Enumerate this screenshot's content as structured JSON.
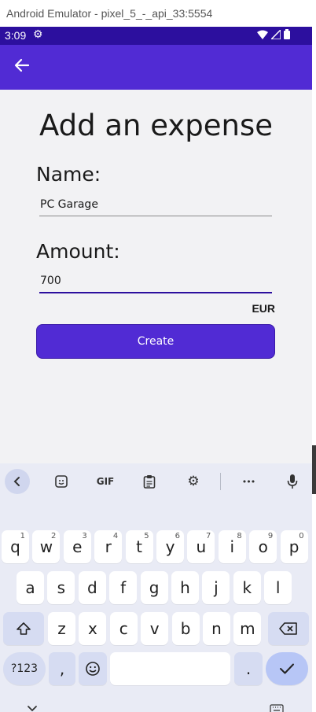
{
  "window": {
    "title": "Android Emulator - pixel_5_-_api_33:5554"
  },
  "status_bar": {
    "time": "3:09"
  },
  "app_bar": {
    "back_icon": "arrow-left-icon"
  },
  "form": {
    "title": "Add an expense",
    "name_label": "Name:",
    "name_value": "PC Garage",
    "amount_label": "Amount:",
    "amount_value": "700",
    "currency": "EUR",
    "create_label": "Create"
  },
  "keyboard": {
    "toolbar": {
      "gif_label": "GIF",
      "more_label": "•••"
    },
    "row1": [
      {
        "key": "q",
        "hint": "1"
      },
      {
        "key": "w",
        "hint": "2"
      },
      {
        "key": "e",
        "hint": "3"
      },
      {
        "key": "r",
        "hint": "4"
      },
      {
        "key": "t",
        "hint": "5"
      },
      {
        "key": "y",
        "hint": "6"
      },
      {
        "key": "u",
        "hint": "7"
      },
      {
        "key": "i",
        "hint": "8"
      },
      {
        "key": "o",
        "hint": "9"
      },
      {
        "key": "p",
        "hint": "0"
      }
    ],
    "row2": [
      "a",
      "s",
      "d",
      "f",
      "g",
      "h",
      "j",
      "k",
      "l"
    ],
    "row3": [
      "z",
      "x",
      "c",
      "v",
      "b",
      "n",
      "m"
    ],
    "sym_label": "?123",
    "comma_label": ",",
    "period_label": "."
  },
  "colors": {
    "accent": "#512bd4",
    "status_bar": "#2c0f9e",
    "keyboard_bg": "#e9ebf5"
  }
}
